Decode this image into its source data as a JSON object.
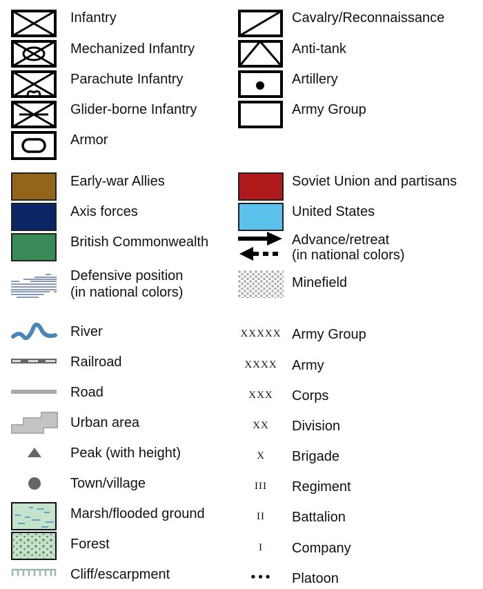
{
  "units_left": [
    {
      "label": "Infantry",
      "icon": "infantry-icon"
    },
    {
      "label": "Mechanized Infantry",
      "icon": "mechanized-infantry-icon"
    },
    {
      "label": "Parachute Infantry",
      "icon": "parachute-infantry-icon"
    },
    {
      "label": "Glider-borne Infantry",
      "icon": "glider-infantry-icon"
    },
    {
      "label": "Armor",
      "icon": "armor-icon"
    }
  ],
  "units_right": [
    {
      "label": "Cavalry/Reconnaissance",
      "icon": "cavalry-icon"
    },
    {
      "label": "Anti-tank",
      "icon": "anti-tank-icon"
    },
    {
      "label": "Artillery",
      "icon": "artillery-icon"
    },
    {
      "label": "Army Group",
      "icon": "army-group-box-icon"
    }
  ],
  "forces": [
    {
      "label": "Early-war Allies",
      "color": "#93641a"
    },
    {
      "label": "Axis forces",
      "color": "#0c2566"
    },
    {
      "label": "British Commonwealth",
      "color": "#3a8a58"
    },
    {
      "label": "Soviet Union and partisans",
      "color": "#b0191c"
    },
    {
      "label": "United States",
      "color": "#5bc2ee"
    }
  ],
  "misc": {
    "advance_line1": "Advance/retreat",
    "advance_line2": "(in national colors)",
    "defensive_line1": "Defensive position",
    "defensive_line2": "(in national colors)",
    "minefield": "Minefield"
  },
  "terrain": [
    {
      "label": "River",
      "icon": "river-icon"
    },
    {
      "label": "Railroad",
      "icon": "railroad-icon"
    },
    {
      "label": "Road",
      "icon": "road-icon"
    },
    {
      "label": "Urban area",
      "icon": "urban-area-icon"
    },
    {
      "label": "Peak (with height)",
      "icon": "peak-icon"
    },
    {
      "label": "Town/village",
      "icon": "town-icon"
    },
    {
      "label": "Marsh/flooded ground",
      "icon": "marsh-icon"
    },
    {
      "label": "Forest",
      "icon": "forest-icon"
    },
    {
      "label": "Cliff/escarpment",
      "icon": "cliff-icon"
    }
  ],
  "echelons": [
    {
      "symbol": "XXXXX",
      "label": "Army Group"
    },
    {
      "symbol": "XXXX",
      "label": "Army"
    },
    {
      "symbol": "XXX",
      "label": "Corps"
    },
    {
      "symbol": "XX",
      "label": "Division"
    },
    {
      "symbol": "X",
      "label": "Brigade"
    },
    {
      "symbol": "III",
      "label": "Regiment"
    },
    {
      "symbol": "II",
      "label": "Battalion"
    },
    {
      "symbol": "I",
      "label": "Company"
    },
    {
      "symbol": "•••",
      "label": "Platoon"
    }
  ]
}
